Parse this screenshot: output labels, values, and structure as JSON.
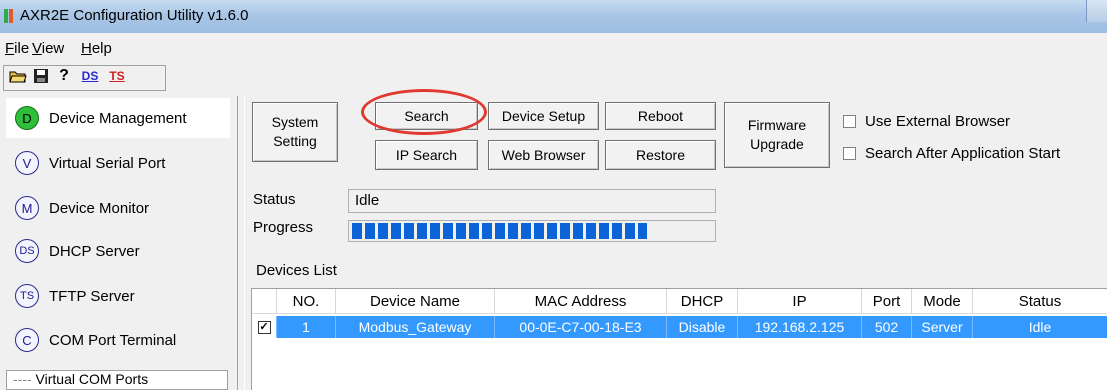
{
  "window": {
    "title": "AXR2E Configuration Utility v1.6.0"
  },
  "menu": [
    "File",
    "View",
    "Help"
  ],
  "toolbar": {
    "ds_label": "DS",
    "ts_label": "TS",
    "help_glyph": "?"
  },
  "sidebar": {
    "items": [
      {
        "badge": "D",
        "label": "Device Management"
      },
      {
        "badge": "V",
        "label": "Virtual Serial Port"
      },
      {
        "badge": "M",
        "label": "Device Monitor"
      },
      {
        "badge": "DS",
        "label": "DHCP Server"
      },
      {
        "badge": "TS",
        "label": "TFTP Server"
      },
      {
        "badge": "C",
        "label": "COM Port Terminal"
      }
    ],
    "tree_item": "Virtual COM Ports"
  },
  "buttons": {
    "system_setting_1": "System",
    "system_setting_2": "Setting",
    "search": "Search",
    "ip_search": "IP Search",
    "device_setup": "Device Setup",
    "web_browser": "Web Browser",
    "reboot": "Reboot",
    "restore": "Restore",
    "firmware_1": "Firmware",
    "firmware_2": "Upgrade"
  },
  "options": {
    "use_external_browser": "Use External Browser",
    "search_after_start": "Search After Application Start"
  },
  "status": {
    "label": "Status",
    "value": "Idle"
  },
  "progress": {
    "label": "Progress",
    "fraction": 0.82
  },
  "devices": {
    "title": "Devices List",
    "columns": [
      "NO.",
      "Device Name",
      "MAC Address",
      "DHCP",
      "IP",
      "Port",
      "Mode",
      "Status"
    ],
    "rows": [
      {
        "no": "1",
        "name": "Modbus_Gateway",
        "mac": "00-0E-C7-00-18-E3",
        "dhcp": "Disable",
        "ip": "192.168.2.125",
        "port": "502",
        "mode": "Server",
        "status": "Idle",
        "checked": true
      }
    ]
  },
  "colors": {
    "selection": "#3399ff",
    "highlight_oval": "#e03a30",
    "progress": "#0a64d8",
    "active_badge": "#2fbf3a"
  }
}
